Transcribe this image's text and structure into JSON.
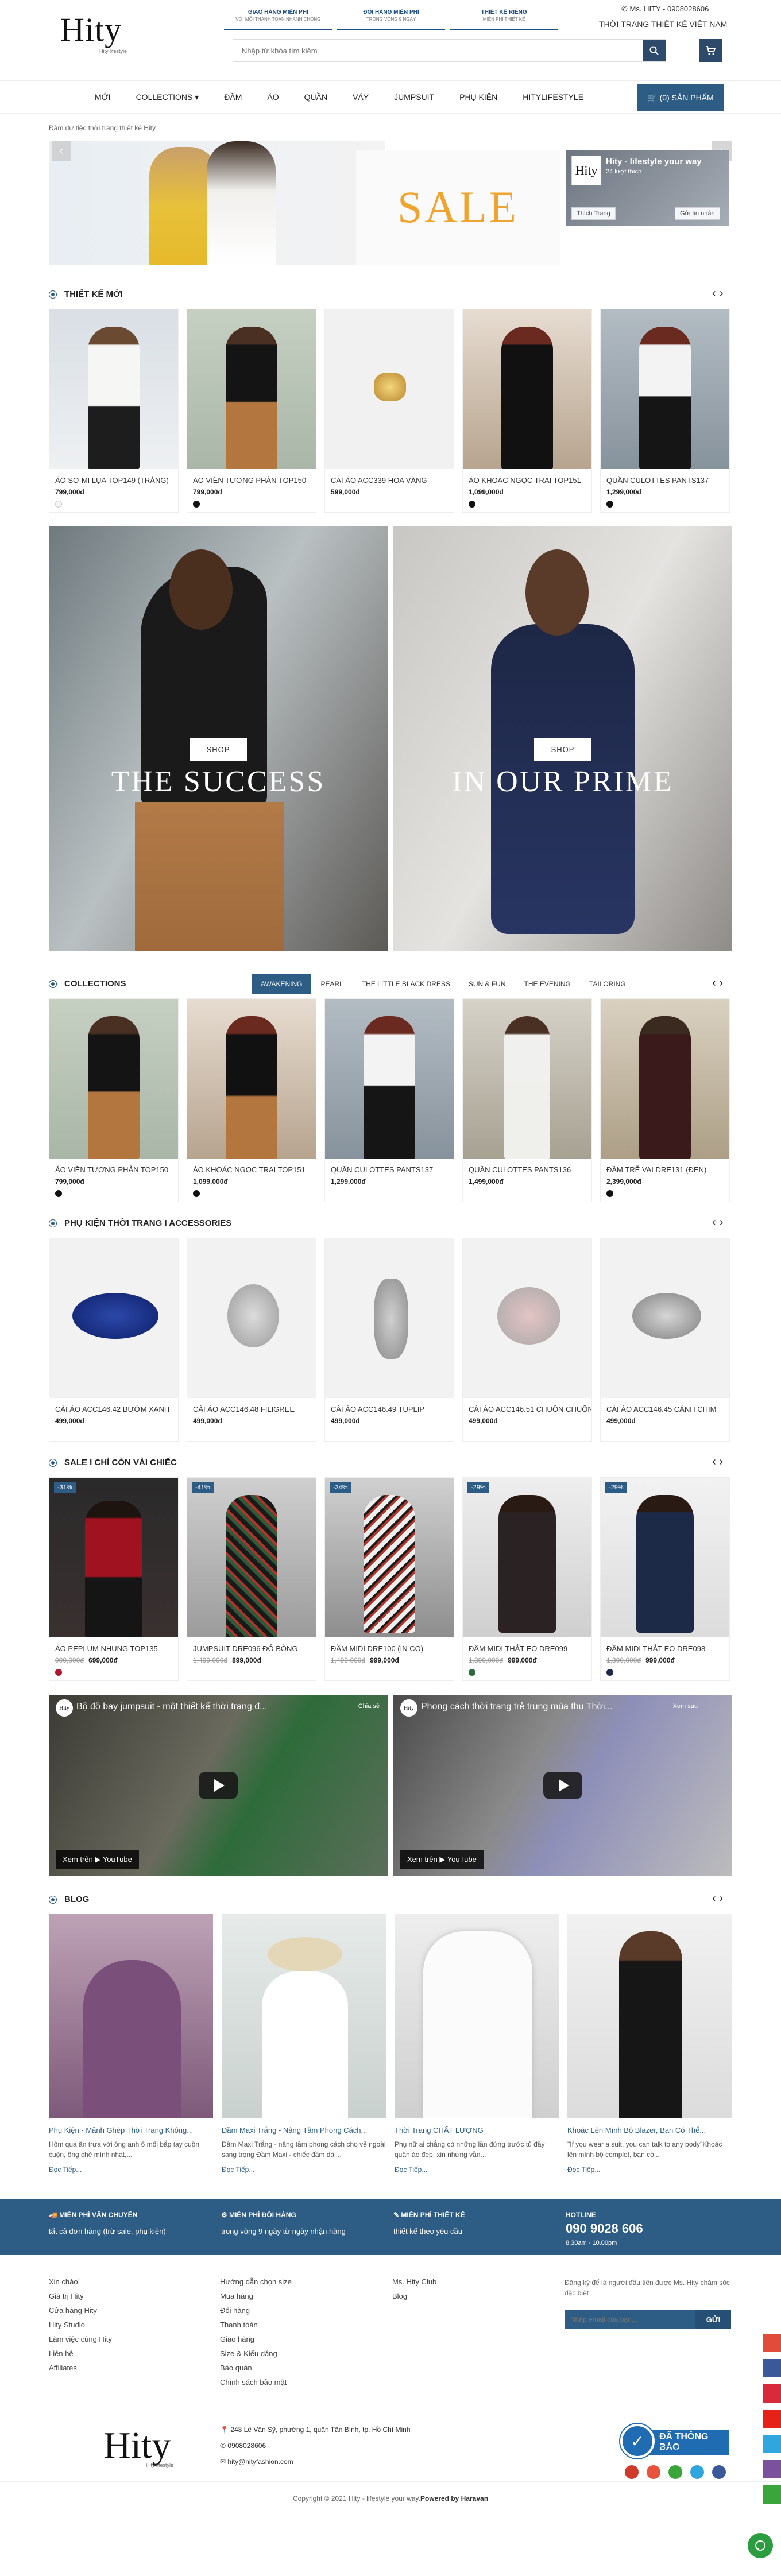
{
  "header": {
    "logo_text": "Hity",
    "logo_sub": "Hity lifestyle",
    "promos": [
      {
        "title": "GIAO HÀNG MIỄN PHÍ",
        "sub": "VỚI MỖI THANH TOÁN NHANH CHÓNG"
      },
      {
        "title": "ĐỔI HÀNG MIỄN PHÍ",
        "sub": "TRONG VÒNG 9 NGÀY"
      },
      {
        "title": "THIẾT KẾ RIÊNG",
        "sub": "MIỄN PHÍ THIẾT KẾ"
      }
    ],
    "hotline": "Ms. HITY - 0908028606",
    "tagline": "THỜI TRANG THIẾT KẾ VIỆT NAM",
    "search_placeholder": "Nhập từ khóa tìm kiếm"
  },
  "nav": {
    "items": [
      "MỚI",
      "COLLECTIONS ▾",
      "ĐẦM",
      "ÁO",
      "QUẦN",
      "VÁY",
      "JUMPSUIT",
      "PHỤ KIỆN",
      "HITYLIFESTYLE"
    ],
    "products_button": "(0) SẢN PHẨM"
  },
  "banner": {
    "alt_text": "Đầm dự tiệc thời trang thiết kế Hity",
    "sale_text": "SALE",
    "fb": {
      "name": "Hity - lifestyle your way",
      "likes": "24 lượt thích",
      "like_btn": "Thích Trang",
      "share_btn": "Gửi tin nhắn"
    }
  },
  "new_section": {
    "title": "THIẾT KẾ MỚI",
    "products": [
      {
        "name": "ÁO SƠ MI LỤA TOP149 (TRẮNG)",
        "price": "799,000đ",
        "swatch": "#f5f5f5"
      },
      {
        "name": "ÁO VIỀN TƯƠNG PHẢN TOP150",
        "price": "799,000đ",
        "swatch": "#111111"
      },
      {
        "name": "CÀI ÁO ACC339 HOA VÀNG",
        "price": "599,000đ",
        "swatch": ""
      },
      {
        "name": "ÁO KHOÁC NGỌC TRAI TOP151",
        "price": "1,099,000đ",
        "swatch": "#111111"
      },
      {
        "name": "QUẦN CULOTTES PANTS137",
        "price": "1,299,000đ",
        "swatch": "#111111"
      }
    ]
  },
  "promo_pair": {
    "left": {
      "button": "SHOP",
      "caption": "THE SUCCESS"
    },
    "right": {
      "button": "SHOP",
      "caption": "IN OUR PRIME"
    }
  },
  "collections": {
    "title": "COLLECTIONS",
    "tabs": [
      "AWAKENING",
      "PEARL",
      "THE LITTLE BLACK DRESS",
      "SUN & FUN",
      "THE EVENING",
      "TAILORING"
    ],
    "products": [
      {
        "name": "ÁO VIỀN TƯƠNG PHẢN TOP150",
        "price": "799,000đ",
        "swatch": "#111111"
      },
      {
        "name": "ÁO KHOÁC NGỌC TRAI TOP151",
        "price": "1,099,000đ",
        "swatch": "#111111"
      },
      {
        "name": "QUẦN CULOTTES PANTS137",
        "price": "1,299,000đ",
        "swatch": ""
      },
      {
        "name": "QUẦN CULOTTES PANTS136",
        "price": "1,499,000đ",
        "swatch": ""
      },
      {
        "name": "ĐẦM TRỄ VAI DRE131 (ĐEN)",
        "price": "2,399,000đ",
        "swatch": "#111111"
      }
    ]
  },
  "accessories": {
    "title": "PHỤ KIỆN THỜI TRANG I ACCESSORIES",
    "products": [
      {
        "name": "CÀI ÁO ACC146.42 BƯỚM XANH",
        "price": "499,000đ"
      },
      {
        "name": "CÀI ÁO ACC146.48 FILIGREE",
        "price": "499,000đ"
      },
      {
        "name": "CÀI ÁO ACC146.49 TUPLIP",
        "price": "499,000đ"
      },
      {
        "name": "CÀI ÁO ACC146.51 CHUỒN CHUỒN",
        "price": "499,000đ"
      },
      {
        "name": "CÀI ÁO ACC146.45 CÁNH CHIM",
        "price": "499,000đ"
      }
    ]
  },
  "sale": {
    "title": "SALE I CHỈ CÒN VÀI CHIẾC",
    "products": [
      {
        "name": "ÁO PEPLUM NHUNG TOP135",
        "badge": "-31%",
        "old": "999,000đ",
        "price": "699,000đ",
        "swatch": "#b0172a"
      },
      {
        "name": "JUMPSUIT DRE096 ĐỎ BÔNG",
        "badge": "-41%",
        "old": "1,499,000đ",
        "price": "899,000đ",
        "swatch": ""
      },
      {
        "name": "ĐẦM MIDI DRE100 (IN CỌ)",
        "badge": "-34%",
        "old": "1,499,000đ",
        "price": "999,000đ",
        "swatch": ""
      },
      {
        "name": "ĐẦM MIDI THẮT EO DRE099",
        "badge": "-29%",
        "old": "1,399,000đ",
        "price": "999,000đ",
        "swatch": "#2c6a3a"
      },
      {
        "name": "ĐẦM MIDI THẮT EO DRE098",
        "badge": "-29%",
        "old": "1,399,000đ",
        "price": "999,000đ",
        "swatch": "#1c2a48"
      }
    ]
  },
  "videos": [
    {
      "title": "Bộ đồ bay jumpsuit - một thiết kế thời trang đ...",
      "share": "Chia sẻ",
      "watch": "Xem trên ▶ YouTube"
    },
    {
      "title": "Phong cách thời trang trẻ trung mùa thu Thời...",
      "share": "Xem sau",
      "watch": "Xem trên ▶ YouTube"
    }
  ],
  "blog": {
    "title": "BLOG",
    "posts": [
      {
        "title": "Phụ Kiện - Mảnh Ghép Thời Trang Không...",
        "desc": "Hôm qua ăn trưa với ông anh 6 mối bắp tay cuồn cuộn, ông chẻ mình nhạt,...",
        "more": "Đọc Tiếp..."
      },
      {
        "title": "Đầm Maxi Trắng - Nâng Tầm Phong Cách...",
        "desc": "Đầm Maxi Trắng - nâng tầm phong cách cho vẻ ngoài sang trọng  Đầm Maxi - chiếc đầm dài...",
        "more": "Đọc Tiếp..."
      },
      {
        "title": "Thời Trang CHẤT LƯỢNG",
        "desc": "Phụ nữ ai chẳng có những lần đứng trước tủ đầy quần áo đẹp, xin nhưng vẫn...",
        "more": "Đọc Tiếp..."
      },
      {
        "title": "Khoác Lên Mình Bộ Blazer, Bạn Có Thể...",
        "desc": "\"If you wear a suit, you can talk to any body\"Khoác lên mình bộ complet, bạn có...",
        "more": "Đọc Tiếp..."
      }
    ]
  },
  "services": [
    {
      "title": "MIỄN PHÍ VẬN CHUYỂN",
      "sub": "tất cả đơn hàng (trừ sale, phụ kiện)"
    },
    {
      "title": "MIỄN PHÍ ĐỔI HÀNG",
      "sub": "trong vòng 9 ngày từ ngày nhận hàng"
    },
    {
      "title": "MIỄN PHÍ THIẾT KẾ",
      "sub": "thiết kế theo yêu cầu"
    },
    {
      "title": "HOTLINE",
      "number": "090 9028 606",
      "hours": "8.30am - 10.00pm"
    }
  ],
  "footer": {
    "col1": [
      "Xin chào!",
      "Giá trị Hity",
      "Cửa hàng Hity",
      "Hity Studio",
      "Làm việc cùng Hity",
      "Liên hệ",
      "Affiliates"
    ],
    "col2": [
      "Hướng dẫn chọn size",
      "Mua hàng",
      "Đổi hàng",
      "Thanh toán",
      "Giao hàng",
      "Size & Kiểu dáng",
      "Bảo quản",
      "Chính sách bảo mật"
    ],
    "col3": [
      "Ms. Hity Club",
      "Blog"
    ],
    "newsletter_text": "Đăng ký để là người đầu tiên được Ms. Hity chăm sóc đặc biệt",
    "newsletter_placeholder": "Nhập email của bạn...",
    "newsletter_btn": "GỬI",
    "address": "248 Lê Văn Sỹ, phường 1, quận Tân Bình, tp. Hồ Chí Minh",
    "phone": "0908028606",
    "email": "hity@hityfashion.com",
    "badge_title": "ĐÃ THÔNG BÁO",
    "badge_sub": "BỘ CÔNG THƯƠNG",
    "copyright": "Copyright © 2021 Hity - lifestyle your way.",
    "powered": "Powered by Haravan"
  }
}
